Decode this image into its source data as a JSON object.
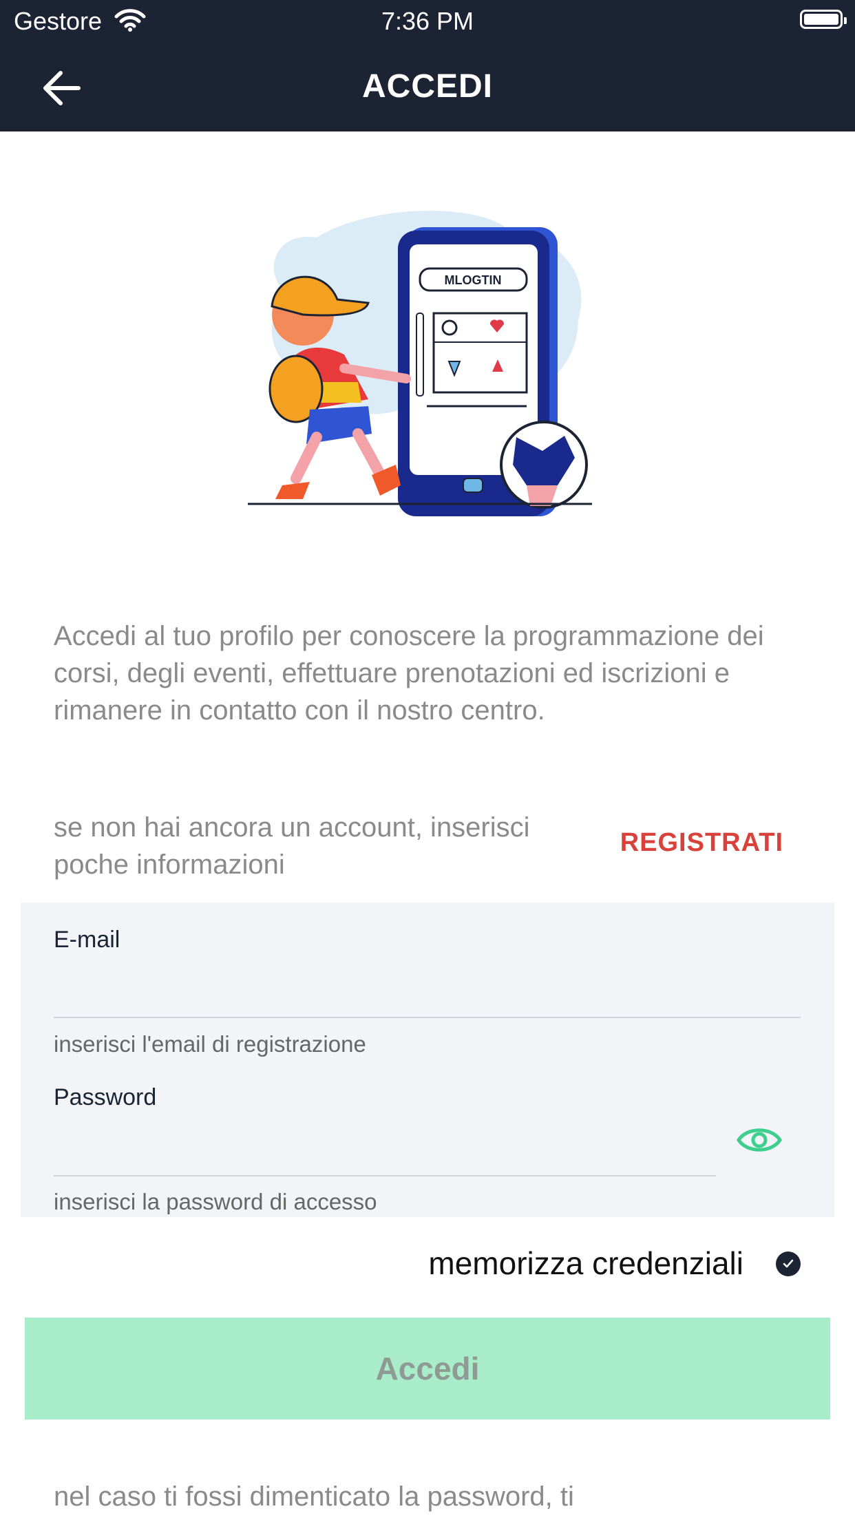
{
  "status_bar": {
    "carrier": "Gestore",
    "time": "7:36 PM"
  },
  "header": {
    "title": "ACCEDI"
  },
  "hero": {
    "illustration": "boy-with-phone-and-ball",
    "phone_label": "MLOGTIN"
  },
  "intro": {
    "text": "Accedi al tuo profilo per conoscere la programmazione dei corsi, degli eventi, effettuare prenotazioni ed iscrizioni e rimanere in contatto con il nostro centro."
  },
  "signup": {
    "text": "se non hai ancora un account, inserisci poche informazioni",
    "link_label": "REGISTRATI"
  },
  "form": {
    "email": {
      "label": "E-mail",
      "value": "",
      "hint": "inserisci l'email di registrazione"
    },
    "password": {
      "label": "Password",
      "value": "",
      "hint": "inserisci la password di accesso"
    }
  },
  "remember": {
    "label": "memorizza credenziali",
    "checked": true
  },
  "login_button": {
    "label": "Accedi"
  },
  "forgot": {
    "text": "nel caso ti fossi dimenticato la password, ti"
  },
  "colors": {
    "header_bg": "#1c2333",
    "accent_red": "#d9423a",
    "accent_green": "#3ecf8e",
    "button_bg": "#a9ecc9"
  }
}
